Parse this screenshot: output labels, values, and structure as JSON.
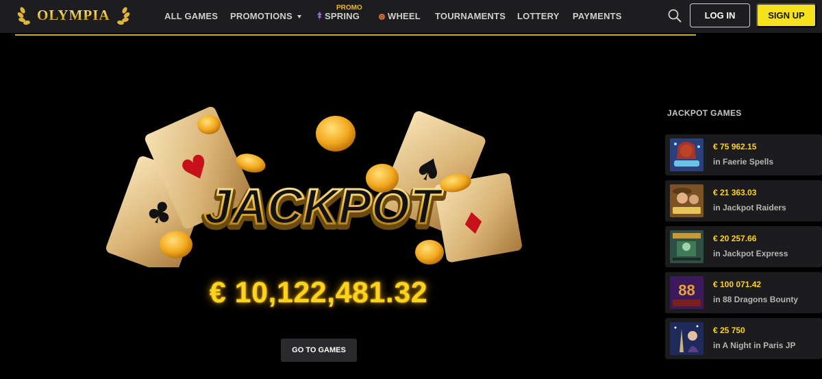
{
  "brand": {
    "name": "OLYMPIA",
    "accent": "#f5e21c",
    "gold": "#c9a93c"
  },
  "nav": {
    "items": [
      {
        "label": "ALL GAMES"
      },
      {
        "label": "PROMOTIONS"
      },
      {
        "label": "SPRING",
        "tag": "PROMO",
        "icon": "spring-icon"
      },
      {
        "label": "WHEEL",
        "icon": "wheel-icon"
      },
      {
        "label": "TOURNAMENTS"
      },
      {
        "label": "LOTTERY"
      },
      {
        "label": "PAYMENTS"
      }
    ],
    "search_icon": "search-icon",
    "login_label": "LOG IN",
    "signup_label": "SIGN UP"
  },
  "hero": {
    "banner_word": "JACKPOT",
    "amount": "€ 10,122,481.32",
    "cta_label": "GO TO GAMES"
  },
  "jackpot_games": {
    "title": "JACKPOT GAMES",
    "items": [
      {
        "amount": "€ 75 962.15",
        "name": "in Faerie Spells",
        "thumb": "faerie-spells-thumbnail"
      },
      {
        "amount": "€ 21 363.03",
        "name": "in Jackpot Raiders",
        "thumb": "jackpot-raiders-thumbnail"
      },
      {
        "amount": "€ 20 257.66",
        "name": "in Jackpot Express",
        "thumb": "jackpot-express-thumbnail"
      },
      {
        "amount": "€ 100 071.42",
        "name": "in 88 Dragons Bounty",
        "thumb": "88-dragons-bounty-thumbnail",
        "thumb_text": "88"
      },
      {
        "amount": "€ 25 750",
        "name": "in A Night in Paris JP",
        "thumb": "night-in-paris-thumbnail"
      }
    ]
  }
}
